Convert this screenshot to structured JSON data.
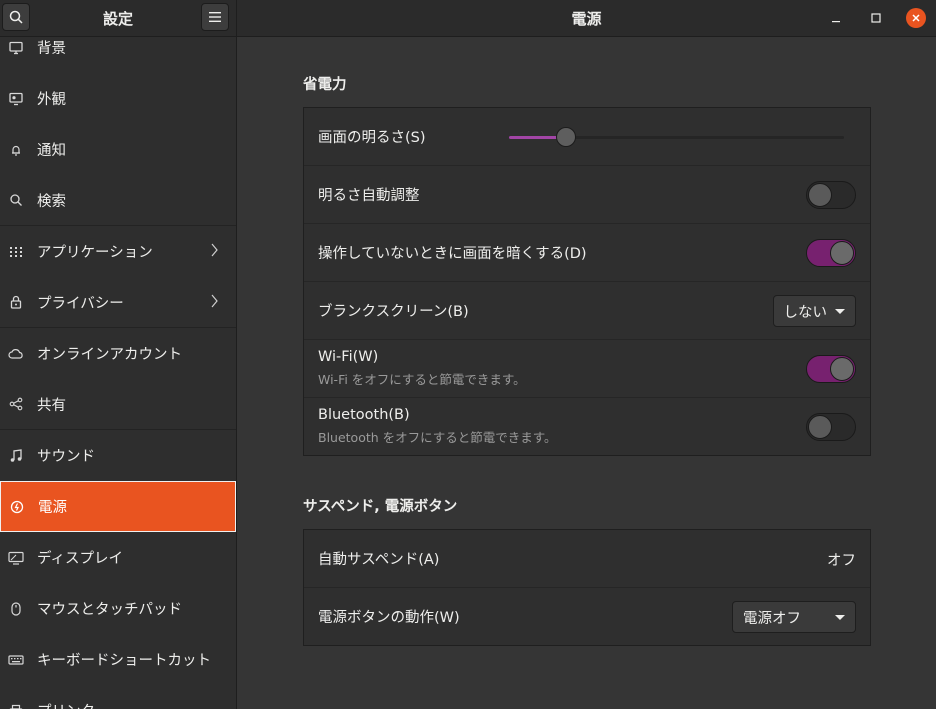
{
  "header": {
    "left_title": "設定",
    "title": "電源",
    "search_icon": "search-icon",
    "menu_icon": "hamburger-icon"
  },
  "sidebar": {
    "items": [
      {
        "label": "背景",
        "icon": "background-icon",
        "sep": false,
        "chev": false
      },
      {
        "label": "外観",
        "icon": "appearance-icon",
        "sep": false,
        "chev": false
      },
      {
        "label": "通知",
        "icon": "bell-icon",
        "sep": false,
        "chev": false
      },
      {
        "label": "検索",
        "icon": "search-icon",
        "sep": true,
        "chev": false
      },
      {
        "label": "アプリケーション",
        "icon": "apps-grid-icon",
        "sep": false,
        "chev": true
      },
      {
        "label": "プライバシー",
        "icon": "lock-icon",
        "sep": true,
        "chev": true
      },
      {
        "label": "オンラインアカウント",
        "icon": "cloud-icon",
        "sep": false,
        "chev": false
      },
      {
        "label": "共有",
        "icon": "share-icon",
        "sep": true,
        "chev": false
      },
      {
        "label": "サウンド",
        "icon": "music-note-icon",
        "sep": false,
        "chev": false
      },
      {
        "label": "電源",
        "icon": "power-icon",
        "sep": false,
        "chev": false,
        "active": true
      },
      {
        "label": "ディスプレイ",
        "icon": "display-icon",
        "sep": false,
        "chev": false
      },
      {
        "label": "マウスとタッチパッド",
        "icon": "mouse-icon",
        "sep": false,
        "chev": false
      },
      {
        "label": "キーボードショートカット",
        "icon": "keyboard-icon",
        "sep": false,
        "chev": false
      },
      {
        "label": "プリンター",
        "icon": "printer-icon",
        "sep": false,
        "chev": false
      }
    ]
  },
  "power_saving": {
    "title": "省電力",
    "brightness_label": "画面の明るさ(S)",
    "brightness_level": 0.17,
    "auto_brightness_label": "明るさ自動調整",
    "auto_brightness_on": false,
    "dim_label": "操作していないときに画面を暗くする(D)",
    "dim_on": true,
    "blank_label": "ブランクスクリーン(B)",
    "blank_value": "しない",
    "wifi_label": "Wi-Fi(W)",
    "wifi_sub": "Wi-Fi をオフにすると節電できます。",
    "wifi_on": true,
    "bt_label": "Bluetooth(B)",
    "bt_sub": "Bluetooth をオフにすると節電できます。",
    "bt_on": false
  },
  "suspend": {
    "title": "サスペンド, 電源ボタン",
    "auto_suspend_label": "自動サスペンド(A)",
    "auto_suspend_value": "オフ",
    "power_button_label": "電源ボタンの動作(W)",
    "power_button_value": "電源オフ"
  },
  "colors": {
    "accent": "#e95420",
    "switch_on": "#77216f",
    "slider_fill": "#a245a6"
  }
}
